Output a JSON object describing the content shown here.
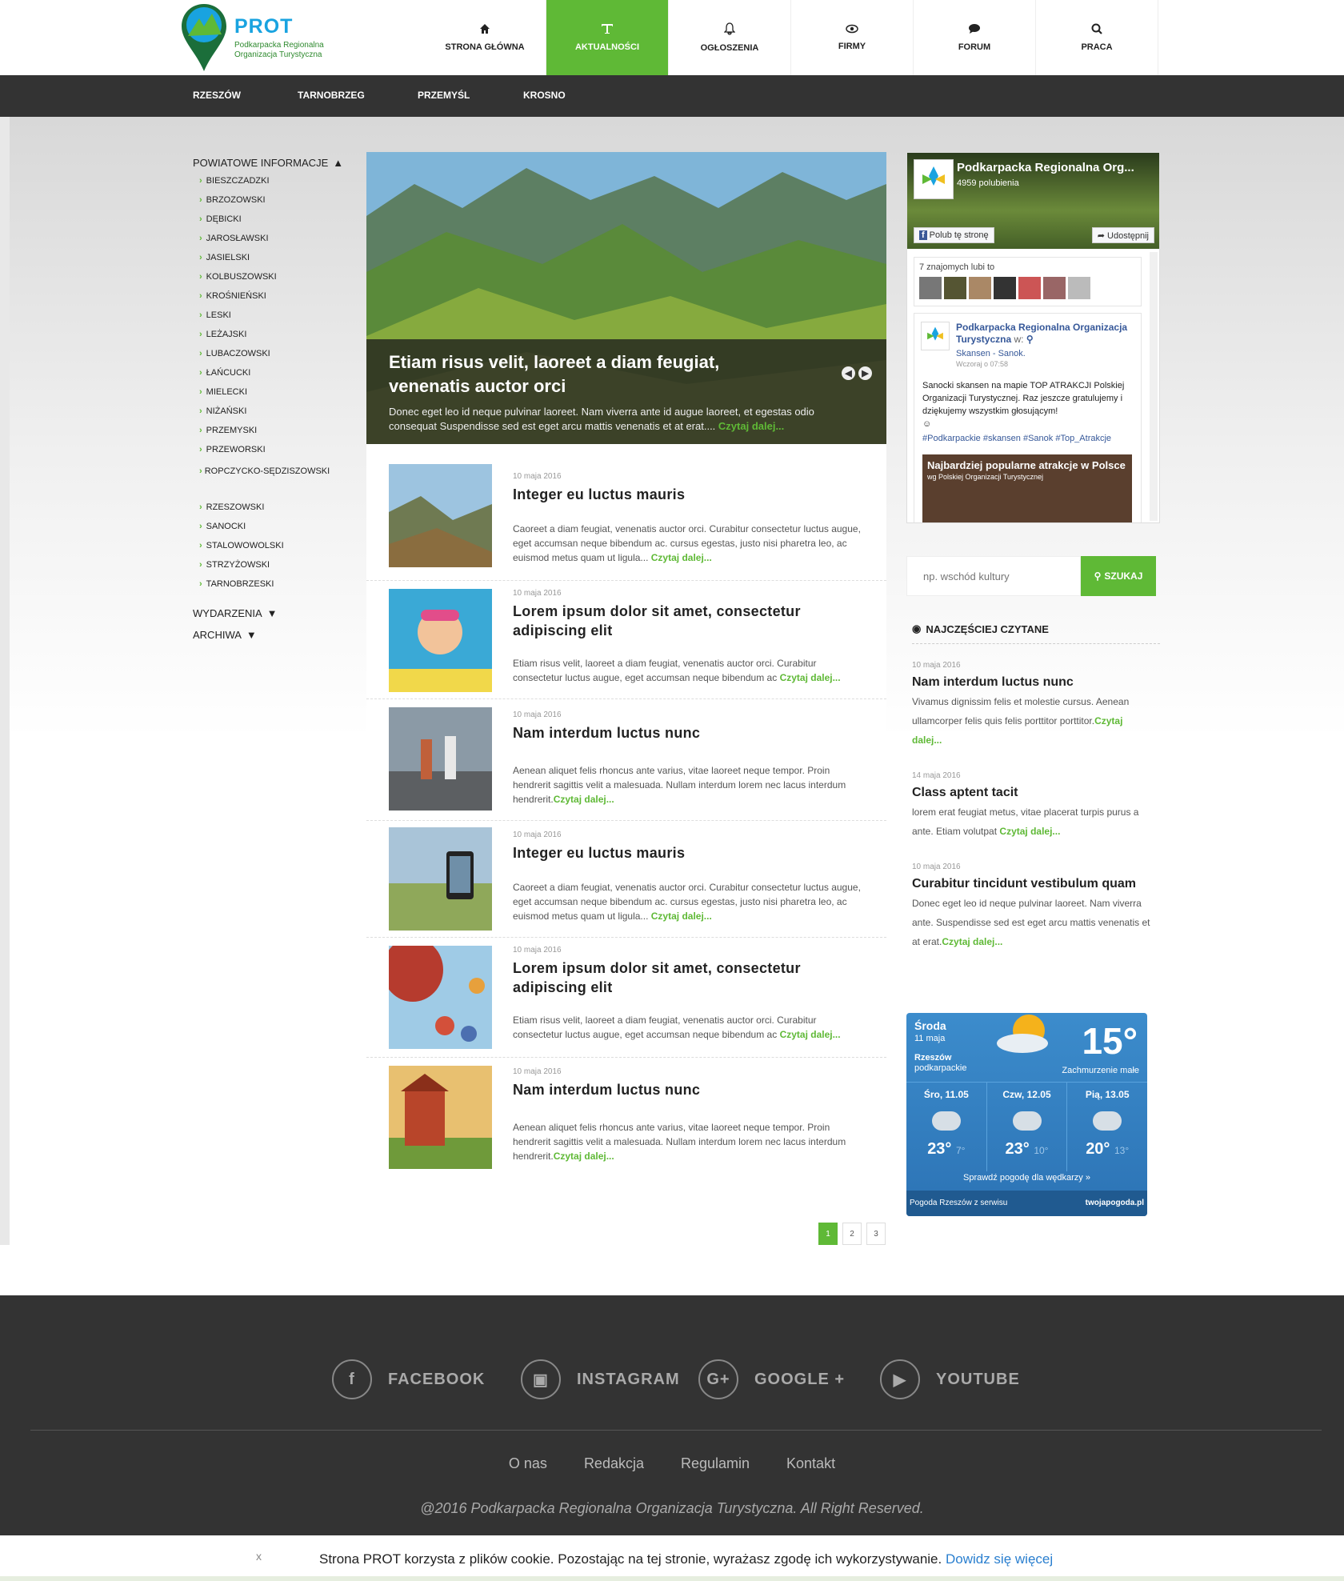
{
  "brand": {
    "name": "PROT",
    "sub1": "Podkarpacka Regionalna",
    "sub2": "Organizacja Turystyczna"
  },
  "nav": [
    {
      "label": "STRONA GŁÓWNA",
      "icon": "home-icon"
    },
    {
      "label": "AKTUALNOŚCI",
      "icon": "text-icon",
      "active": true
    },
    {
      "label": "OGŁOSZENIA",
      "icon": "bell-icon"
    },
    {
      "label": "FIRMY",
      "icon": "eye-icon"
    },
    {
      "label": "FORUM",
      "icon": "chat-icon"
    },
    {
      "label": "PRACA",
      "icon": "search-icon"
    }
  ],
  "subnav": [
    "RZESZÓW",
    "TARNOBRZEG",
    "PRZEMYŚL",
    "KROSNO"
  ],
  "sidebar": {
    "section1": "POWIATOWE INFORMACJE",
    "items": [
      "BIESZCZADZKI",
      "BRZOZOWSKI",
      "DĘBICKI",
      "JAROSŁAWSKI",
      "JASIELSKI",
      "KOLBUSZOWSKI",
      "KROŚNIEŃSKI",
      "LESKI",
      "LEŻAJSKI",
      "LUBACZOWSKI",
      "ŁAŃCUCKI",
      "MIELECKI",
      "NIŻAŃSKI",
      "PRZEMYSKI",
      "PRZEWORSKI",
      "ROPCZYCKO-SĘDZISZOWSKI",
      "RZESZOWSKI",
      "SANOCKI",
      "STALOWOWOLSKI",
      "STRZYŻOWSKI",
      "TARNOBRZESKI"
    ],
    "section2": "WYDARZENIA",
    "section3": "ARCHIWA"
  },
  "hero": {
    "title": "Etiam risus velit, laoreet a diam feugiat, venenatis auctor orci",
    "text": "Donec eget leo id neque pulvinar laoreet. Nam viverra ante id augue laoreet, et egestas odio consequat Suspendisse sed est eget arcu mattis venenatis et at erat....",
    "more": "Czytaj dalej..."
  },
  "articles": [
    {
      "date": "10 maja 2016",
      "title": "Integer eu luctus mauris",
      "text": "Caoreet a diam feugiat, venenatis auctor orci. Curabitur consectetur luctus augue, eget accumsan neque bibendum ac. cursus egestas, justo nisi pharetra leo, ac euismod metus quam ut ligula... ",
      "more": "Czytaj dalej..."
    },
    {
      "date": "10 maja 2016",
      "title": "Lorem ipsum dolor sit amet, consectetur adipiscing elit",
      "text": "Etiam risus velit, laoreet a diam feugiat, venenatis auctor orci. Curabitur consectetur luctus augue, eget accumsan neque bibendum ac ",
      "more": "Czytaj dalej..."
    },
    {
      "date": "10 maja 2016",
      "title": "Nam interdum luctus nunc",
      "text": "Aenean aliquet felis rhoncus ante varius, vitae laoreet neque tempor. Proin hendrerit sagittis velit a malesuada. Nullam interdum lorem nec lacus interdum hendrerit.",
      "more": "Czytaj dalej..."
    },
    {
      "date": "10 maja 2016",
      "title": "Integer eu luctus mauris",
      "text": "Caoreet a diam feugiat, venenatis auctor orci. Curabitur consectetur luctus augue, eget accumsan neque bibendum ac. cursus egestas, justo nisi pharetra leo, ac euismod metus quam ut ligula... ",
      "more": "Czytaj dalej..."
    },
    {
      "date": "10 maja 2016",
      "title": "Lorem ipsum dolor sit amet, consectetur adipiscing elit",
      "text": "Etiam risus velit, laoreet a diam feugiat, venenatis auctor orci. Curabitur consectetur luctus augue, eget accumsan neque bibendum ac ",
      "more": "Czytaj dalej..."
    },
    {
      "date": "10 maja 2016",
      "title": "Nam interdum luctus nunc",
      "text": "Aenean aliquet felis rhoncus ante varius, vitae laoreet neque tempor. Proin hendrerit sagittis velit a malesuada. Nullam interdum lorem nec lacus interdum hendrerit.",
      "more": "Czytaj dalej..."
    }
  ],
  "pager": [
    "1",
    "2",
    "3"
  ],
  "facebook": {
    "name": "Podkarpacka Regionalna Org...",
    "likes": "4959 polubienia",
    "like_btn": "Polub tę stronę",
    "share_btn": "Udostępnij",
    "friends": "7 znajomych lubi to",
    "post_name": "Podkarpacka Regionalna Organizacja Turystyczna",
    "post_w": "w:",
    "post_loc": "Skansen - Sanok.",
    "post_time": "Wczoraj o 07:58",
    "post_body": "Sanocki skansen na mapie TOP ATRAKCJI Polskiej Organizacji Turystycznej. Raz jeszcze gratulujemy i dziękujemy wszystkim głosującym!",
    "post_tags": "#Podkarpackie #skansen #Sanok #Top_Atrakcje",
    "promo": "Najbardziej popularne atrakcje w Polsce",
    "promo_sub": "wg Polskiej Organizacji Turystycznej"
  },
  "search": {
    "placeholder": "np. wschód kultury",
    "button": "SZUKAJ"
  },
  "popular": {
    "heading": "NAJCZĘŚCIEJ CZYTANE",
    "items": [
      {
        "date": "10 maja 2016",
        "title": "Nam interdum luctus nunc",
        "text": "Vivamus dignissim felis et molestie cursus. Aenean ullamcorper felis quis felis porttitor porttitor.",
        "more": "Czytaj dalej..."
      },
      {
        "date": "14 maja 2016",
        "title": "Class aptent tacit",
        "text": "lorem erat feugiat metus, vitae placerat turpis purus a ante. Etiam volutpat ",
        "more": "Czytaj dalej..."
      },
      {
        "date": "10 maja 2016",
        "title": "Curabitur tincidunt vestibulum quam",
        "text": "Donec eget leo id neque pulvinar laoreet. Nam viverra ante. Suspendisse sed est eget arcu mattis venenatis et at erat.",
        "more": "Czytaj dalej..."
      }
    ]
  },
  "weather": {
    "day": "Środa",
    "date": "11 maja",
    "city": "Rzeszów",
    "region": "podkarpackie",
    "temp": "15°",
    "cond": "Zachmurzenie małe",
    "forecast": [
      {
        "label": "Śro, 11.05",
        "hi": "23°",
        "lo": "7°"
      },
      {
        "label": "Czw, 12.05",
        "hi": "23°",
        "lo": "10°"
      },
      {
        "label": "Pią, 13.05",
        "hi": "20°",
        "lo": "13°"
      }
    ],
    "link": "Sprawdź pogodę dla wędkarzy »",
    "foot_left": "Pogoda Rzeszów z serwisu",
    "foot_right": "twojapogoda.pl"
  },
  "footer": {
    "social": [
      "FACEBOOK",
      "INSTAGRAM",
      "GOOGLE +",
      "YOUTUBE"
    ],
    "links": [
      "O nas",
      "Redakcja",
      "Regulamin",
      "Kontakt"
    ],
    "copy": "@2016 Podkarpacka Regionalna Organizacja Turystyczna. All Right Reserved."
  },
  "cookie": {
    "close": "x",
    "msg": "Strona PROT   korzysta z plików cookie. Pozostając na tej stronie, wyrażasz zgodę ich wykorzystywanie.",
    "more": "Dowidz się więcej"
  }
}
